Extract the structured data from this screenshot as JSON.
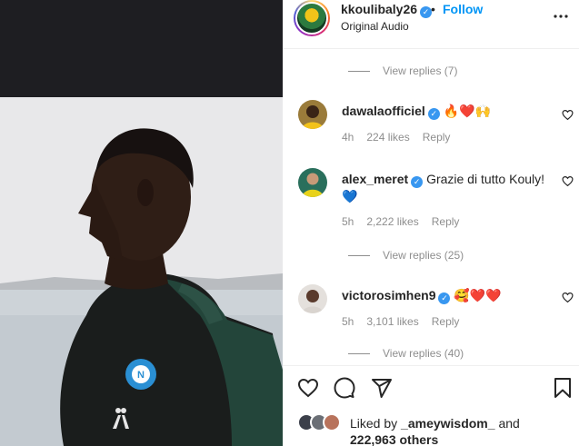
{
  "header": {
    "username": "kkoulibaly26",
    "verified_glyph": "✓",
    "separator": "•",
    "follow_label": "Follow",
    "audio_label": "Original Audio",
    "more_icon": "more-horizontal-icon"
  },
  "comments": [
    {
      "type": "view_replies",
      "label": "View replies (7)"
    },
    {
      "type": "comment",
      "username": "dawalaofficiel",
      "verified": true,
      "text": "",
      "emojis": "🔥❤️🙌",
      "time": "4h",
      "likes": "224 likes",
      "reply_label": "Reply"
    },
    {
      "type": "comment",
      "username": "alex_meret",
      "verified": true,
      "text": "Grazie di tutto Kouly!",
      "emojis": "💙",
      "time": "5h",
      "likes": "2,222 likes",
      "reply_label": "Reply"
    },
    {
      "type": "view_replies",
      "label": "View replies (25)"
    },
    {
      "type": "comment",
      "username": "victorosimhen9",
      "verified": true,
      "text": "",
      "emojis": "🥰❤️❤️",
      "time": "5h",
      "likes": "3,101 likes",
      "reply_label": "Reply"
    },
    {
      "type": "view_replies",
      "label": "View replies (40)"
    }
  ],
  "actions": {
    "like_icon": "heart-icon",
    "comment_icon": "comment-icon",
    "share_icon": "send-icon",
    "save_icon": "bookmark-icon"
  },
  "likes": {
    "prefix": "Liked by",
    "user": "_ameywisdom_",
    "joiner": "and",
    "count": "222,963 others"
  },
  "colors": {
    "accent": "#0095f6",
    "verified": "#3897f0",
    "muted": "#8e8e8e",
    "text": "#262626"
  }
}
